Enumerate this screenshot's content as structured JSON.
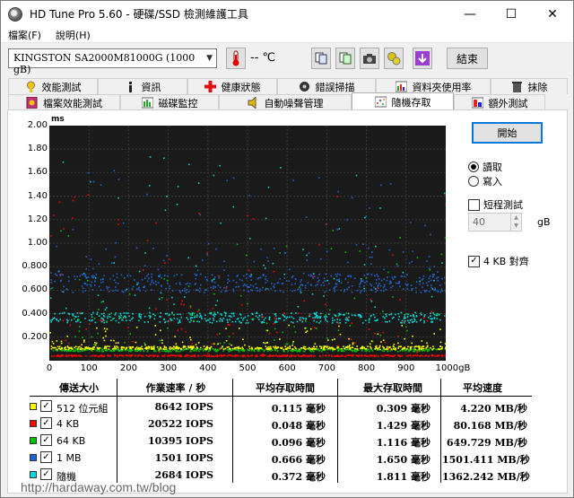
{
  "window": {
    "title": "HD Tune Pro 5.60 - 硬碟/SSD 檢測維護工具",
    "minimize": "—",
    "maximize": "☐",
    "close": "✕"
  },
  "menu": [
    "檔案(F)",
    "說明(H)"
  ],
  "toolbar": {
    "drive": "KINGSTON SA2000M81000G (1000 gB)",
    "temperature": "-- ℃",
    "exit_label": "結束"
  },
  "tabs_row1": [
    "效能測試",
    "資訊",
    "健康狀態",
    "錯誤掃描",
    "資料夾使用率",
    "抹除"
  ],
  "tabs_row2": [
    "檔案效能測試",
    "磁碟監控",
    "自動噪聲管理",
    "隨機存取",
    "額外測試"
  ],
  "active_tab": "隨機存取",
  "controls": {
    "start_label": "開始",
    "read_label": "讀取",
    "write_label": "寫入",
    "mode": "read",
    "short_test_label": "短程測試",
    "short_test_checked": false,
    "short_test_value": "40",
    "short_test_unit": "gB",
    "align_label": "4 KB 對齊",
    "align_checked": true
  },
  "chart_data": {
    "type": "scatter",
    "ylabel": "ms",
    "ylim": [
      0,
      2.0
    ],
    "xlim": [
      0,
      1000
    ],
    "yticks": [
      "2.00",
      "1.80",
      "1.60",
      "1.40",
      "1.20",
      "1.00",
      "0.800",
      "0.600",
      "0.400",
      "0.200"
    ],
    "xticks": [
      "0",
      "100",
      "200",
      "300",
      "400",
      "500",
      "600",
      "700",
      "800",
      "900",
      "1000gB"
    ],
    "grid": true,
    "series": [
      {
        "name": "512 位元組",
        "color": "#ffff00",
        "typical": 0.115,
        "max": 0.309
      },
      {
        "name": "4 KB",
        "color": "#ff0000",
        "typical": 0.048,
        "max": 1.429
      },
      {
        "name": "64 KB",
        "color": "#00c000",
        "typical": 0.096,
        "max": 1.116
      },
      {
        "name": "1 MB",
        "color": "#1e64d2",
        "typical": 0.666,
        "max": 1.65
      },
      {
        "name": "隨機",
        "color": "#00d8d8",
        "typical": 0.372,
        "max": 1.811
      }
    ]
  },
  "table": {
    "headers": [
      "傳送大小",
      "作業速率 / 秒",
      "平均存取時間",
      "最大存取時間",
      "平均速度"
    ],
    "rows": [
      {
        "label": "512 位元組",
        "color": "#ffff00",
        "checked": true,
        "ops": "8642 IOPS",
        "avg": "0.115 毫秒",
        "max": "0.309 毫秒",
        "speed": "4.220 MB/秒"
      },
      {
        "label": "4 KB",
        "color": "#ff0000",
        "checked": true,
        "ops": "20522 IOPS",
        "avg": "0.048 毫秒",
        "max": "1.429 毫秒",
        "speed": "80.168 MB/秒"
      },
      {
        "label": "64 KB",
        "color": "#00c000",
        "checked": true,
        "ops": "10395 IOPS",
        "avg": "0.096 毫秒",
        "max": "1.116 毫秒",
        "speed": "649.729 MB/秒"
      },
      {
        "label": "1 MB",
        "color": "#1e64d2",
        "checked": true,
        "ops": "1501 IOPS",
        "avg": "0.666 毫秒",
        "max": "1.650 毫秒",
        "speed": "1501.411 MB/秒"
      },
      {
        "label": "隨機",
        "color": "#00d8d8",
        "checked": true,
        "ops": "2684 IOPS",
        "avg": "0.372 毫秒",
        "max": "1.811 毫秒",
        "speed": "1362.242 MB/秒"
      }
    ]
  },
  "watermark": "http://hardaway.com.tw/blog"
}
